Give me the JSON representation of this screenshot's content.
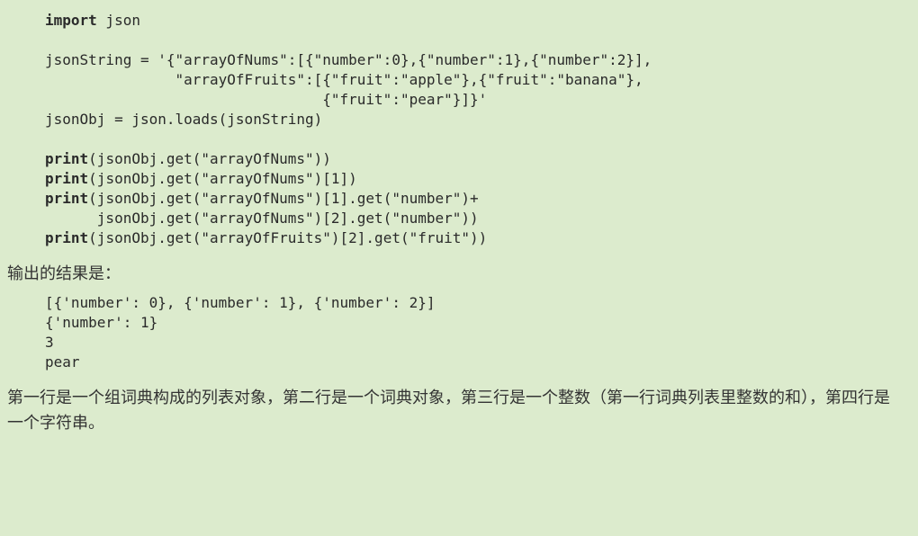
{
  "code": {
    "l1a": "import",
    "l1b": " json",
    "blank1": "",
    "l2": "jsonString = '{\"arrayOfNums\":[{\"number\":0},{\"number\":1},{\"number\":2}],",
    "l3": "               \"arrayOfFruits\":[{\"fruit\":\"apple\"},{\"fruit\":\"banana\"},",
    "l4": "                                {\"fruit\":\"pear\"}]}'",
    "l5": "jsonObj = json.loads(jsonString)",
    "blank2": "",
    "l6a": "print",
    "l6b": "(jsonObj.get(\"arrayOfNums\"))",
    "l7a": "print",
    "l7b": "(jsonObj.get(\"arrayOfNums\")[1])",
    "l8a": "print",
    "l8b": "(jsonObj.get(\"arrayOfNums\")[1].get(\"number\")+",
    "l9": "      jsonObj.get(\"arrayOfNums\")[2].get(\"number\"))",
    "l10a": "print",
    "l10b": "(jsonObj.get(\"arrayOfFruits\")[2].get(\"fruit\"))"
  },
  "label_output": "输出的结果是：",
  "output": {
    "o1": "[{'number': 0}, {'number': 1}, {'number': 2}]",
    "o2": "{'number': 1}",
    "o3": "3",
    "o4": "pear"
  },
  "explain": "第一行是一个组词典构成的列表对象，第二行是一个词典对象，第三行是一个整数（第一行词典列表里整数的和），第四行是一个字符串。"
}
